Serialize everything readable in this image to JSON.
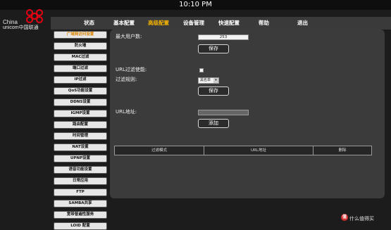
{
  "status_bar": {
    "time": "10:10 PM"
  },
  "logo": {
    "line1": "China",
    "line2": "unicom中国联通",
    "color": "#e60012"
  },
  "nav": {
    "items": [
      {
        "label": "状态"
      },
      {
        "label": "基本配置"
      },
      {
        "label": "高级配置",
        "active": true
      },
      {
        "label": "设备管理"
      },
      {
        "label": "快速配置"
      },
      {
        "label": "帮助"
      },
      {
        "label": "退出"
      }
    ],
    "active_color": "#f5b400"
  },
  "sidebar": {
    "items": [
      {
        "label": "广域网访问设置",
        "active": true
      },
      {
        "label": "防火墙"
      },
      {
        "label": "MAC过滤"
      },
      {
        "label": "端口过滤"
      },
      {
        "label": "IP过滤"
      },
      {
        "label": "QoS功能设置"
      },
      {
        "label": "DDNS设置"
      },
      {
        "label": "IGMP设置"
      },
      {
        "label": "路由配置"
      },
      {
        "label": "时间管理"
      },
      {
        "label": "NAT设置"
      },
      {
        "label": "UPNP设置"
      },
      {
        "label": "语音功能设置"
      },
      {
        "label": "日常应用"
      },
      {
        "label": "FTP"
      },
      {
        "label": "SAMBA共享"
      },
      {
        "label": "宽带普遍性服务"
      },
      {
        "label": "LOID 配置"
      }
    ]
  },
  "max_users": {
    "label": "最大用户数:",
    "value": "253",
    "save": "保存"
  },
  "url_filter": {
    "enable_label": "URL过滤使能:",
    "enabled": false,
    "rule_label": "过滤规则:",
    "rule_value": "黑名单",
    "save": "保存"
  },
  "url_address": {
    "label": "URL地址:",
    "value": "",
    "add": "添加"
  },
  "table": {
    "headers": [
      "过滤模式",
      "URL地址",
      "删除"
    ]
  },
  "watermark": {
    "icon": "值",
    "text": "什么值得买"
  }
}
